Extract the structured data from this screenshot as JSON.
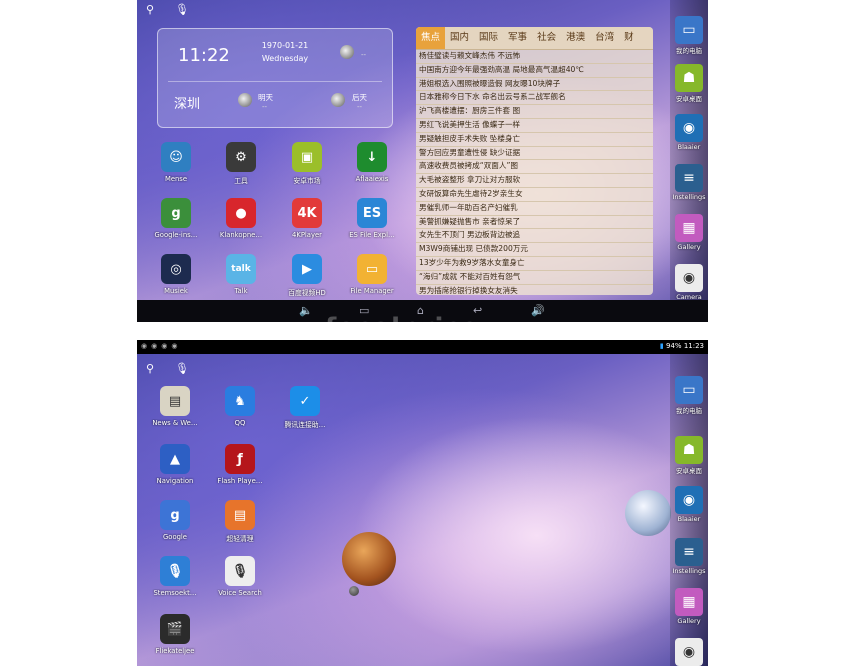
{
  "screen1": {
    "search": {
      "search_icon": "search-icon",
      "mic_icon": "mic-icon"
    },
    "clock": {
      "time": "11:22",
      "date": "1970-01-21",
      "weekday": "Wednesday",
      "city": "深圳",
      "today_dash": "--",
      "tomorrow_label": "明天",
      "tomorrow_dash": "--",
      "after_label": "后天",
      "after_dash": "--"
    },
    "news": {
      "tabs": [
        "焦点",
        "国内",
        "国际",
        "军事",
        "社会",
        "港澳",
        "台湾",
        "财"
      ],
      "items": [
        "杨佳璧读与赖文峰杰伟 不远怖",
        "中国南方迎今年最强劲高温 局地最高气温超40℃",
        "港姐根选入围照被曝造假 网友曝10块牌子",
        "日本雅称今日下水 命名出云号系二战军舰名",
        "沪飞高楼遭摆：厨房三件套 图",
        "男红飞说美押生活 像蝶子一样",
        "男疑触担皮手术失败 坠楼身亡",
        "警方回应男童遭性侵 缺少证据",
        "高速收费员被拷成“双面人”图",
        "大毛被盗整形 拿刀让对方服软",
        "女研饭算命先生虐待2岁亲生女",
        "男催乳师一年助百名产妇催乳",
        "美警抓嫌疑抛售市 亲者惊呆了",
        "女先生不顶门 男边板背边被追",
        "M3W9商铺出现 已债款200万元",
        "13岁少年为救9岁落水女童身亡",
        "“海归”成就 不能对百姓有怨气",
        "男为插席抢银行掉换女友消失"
      ]
    },
    "apps": [
      {
        "label": "Mense",
        "icon": "contacts-icon"
      },
      {
        "label": "工具",
        "icon": "tools-icon"
      },
      {
        "label": "安卓市场",
        "icon": "market-icon"
      },
      {
        "label": "Aflaaiexis",
        "icon": "download-icon"
      },
      {
        "label": "Google-ins…",
        "icon": "google-settings-icon"
      },
      {
        "label": "Klankopne…",
        "icon": "recorder-icon"
      },
      {
        "label": "4KPlayer",
        "icon": "4k-player-icon"
      },
      {
        "label": "ES File Expl…",
        "icon": "es-file-explorer-icon"
      },
      {
        "label": "Musiek",
        "icon": "music-icon"
      },
      {
        "label": "Talk",
        "icon": "talk-icon"
      },
      {
        "label": "百度视频HD",
        "icon": "baidu-video-icon"
      },
      {
        "label": "File Manager",
        "icon": "folder-icon"
      }
    ],
    "dock": [
      {
        "label": "我的电脑",
        "icon": "computer-icon"
      },
      {
        "label": "安卓桌面",
        "icon": "android-icon"
      },
      {
        "label": "Blaaier",
        "icon": "browser-icon"
      },
      {
        "label": "Instellings",
        "icon": "settings-icon"
      },
      {
        "label": "Gallery",
        "icon": "gallery-icon"
      },
      {
        "label": "Camera",
        "icon": "camera-icon"
      }
    ],
    "watermark": "focalprice"
  },
  "screen2": {
    "status": {
      "battery": "94%",
      "time": "11:23"
    },
    "apps": [
      {
        "label": "News & We…",
        "icon": "news-weather-icon"
      },
      {
        "label": "QQ",
        "icon": "qq-icon"
      },
      {
        "label": "腾讯连接助…",
        "icon": "tencent-connect-icon"
      },
      {
        "label": "Navigation",
        "icon": "navigation-icon"
      },
      {
        "label": "Flash Playe…",
        "icon": "flash-player-icon"
      },
      {
        "label": "Google",
        "icon": "google-search-icon"
      },
      {
        "label": "超轻清理",
        "icon": "cleaner-icon"
      },
      {
        "label": "Stemsoekt…",
        "icon": "voice-search-icon"
      },
      {
        "label": "Voice Search",
        "icon": "mic-search-icon"
      },
      {
        "label": "Fliekateljee",
        "icon": "movie-studio-icon"
      }
    ],
    "dock": [
      {
        "label": "我的电脑",
        "icon": "computer-icon"
      },
      {
        "label": "安卓桌面",
        "icon": "android-icon"
      },
      {
        "label": "Blaaier",
        "icon": "browser-icon"
      },
      {
        "label": "Instellings",
        "icon": "settings-icon"
      },
      {
        "label": "Gallery",
        "icon": "gallery-icon"
      },
      {
        "label": "Camera",
        "icon": "camera-icon"
      }
    ]
  },
  "colors": {
    "news_active_tab": "#e8a23c",
    "battery": "#2ba2ff"
  }
}
